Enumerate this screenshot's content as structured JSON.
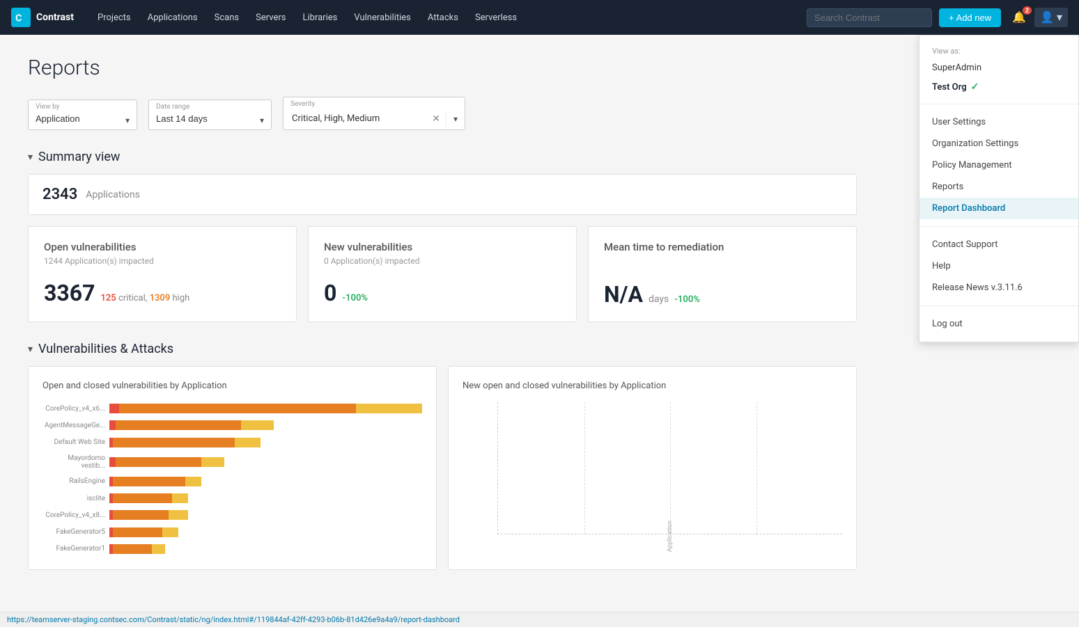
{
  "navbar": {
    "logo_text": "Contrast",
    "nav_items": [
      {
        "label": "Projects",
        "id": "projects"
      },
      {
        "label": "Applications",
        "id": "applications"
      },
      {
        "label": "Scans",
        "id": "scans"
      },
      {
        "label": "Servers",
        "id": "servers"
      },
      {
        "label": "Libraries",
        "id": "libraries"
      },
      {
        "label": "Vulnerabilities",
        "id": "vulnerabilities"
      },
      {
        "label": "Attacks",
        "id": "attacks"
      },
      {
        "label": "Serverless",
        "id": "serverless"
      }
    ],
    "search_placeholder": "Search Contrast",
    "add_new_label": "+ Add new",
    "notification_count": "2"
  },
  "dropdown_menu": {
    "view_as_label": "View as:",
    "users": [
      {
        "label": "SuperAdmin",
        "active": false
      },
      {
        "label": "Test Org",
        "active": true
      }
    ],
    "items": [
      {
        "label": "User Settings",
        "id": "user-settings",
        "highlighted": false
      },
      {
        "label": "Organization Settings",
        "id": "org-settings",
        "highlighted": false
      },
      {
        "label": "Policy Management",
        "id": "policy-mgmt",
        "highlighted": false
      },
      {
        "label": "Reports",
        "id": "reports",
        "highlighted": false
      },
      {
        "label": "Report Dashboard",
        "id": "report-dashboard",
        "highlighted": true
      },
      {
        "label": "Contact Support",
        "id": "contact-support",
        "highlighted": false
      },
      {
        "label": "Help",
        "id": "help",
        "highlighted": false
      },
      {
        "label": "Release News v.3.11.6",
        "id": "release-news",
        "highlighted": false
      },
      {
        "label": "Log out",
        "id": "logout",
        "highlighted": false
      }
    ]
  },
  "page": {
    "title": "Reports"
  },
  "filters": {
    "view_by_label": "View by",
    "view_by_value": "Application",
    "date_range_label": "Date range",
    "date_range_value": "Last 14 days",
    "severity_label": "Severity",
    "severity_value": "Critical, High, Medium"
  },
  "summary_view": {
    "title": "Summary view",
    "app_count": "2343",
    "app_count_label": "Applications",
    "metrics": [
      {
        "title": "Open vulnerabilities",
        "subtitle": "1244 Application(s) impacted",
        "value": "3367",
        "details": "125 critical, 1309 high",
        "change": null,
        "unit": null
      },
      {
        "title": "New vulnerabilities",
        "subtitle": "0 Application(s) impacted",
        "value": "0",
        "details": null,
        "change": "-100%",
        "unit": null
      },
      {
        "title": "Mean time to remediation",
        "subtitle": null,
        "value": "N/A",
        "details": null,
        "change": "-100%",
        "unit": "days"
      }
    ]
  },
  "vulns_section": {
    "title": "Vulnerabilities & Attacks",
    "chart1_title": "Open and closed vulnerabilities by Application",
    "chart2_title": "New open and closed vulnerabilities by Application",
    "bars": [
      {
        "label": "CorePolicy_v4_x6...",
        "orange": 72,
        "yellow": 20,
        "red": 3
      },
      {
        "label": "AgentMessageGe...",
        "orange": 38,
        "yellow": 10,
        "red": 2
      },
      {
        "label": "Default Web Site",
        "orange": 37,
        "yellow": 8,
        "red": 1
      },
      {
        "label": "Mayordomo vestib...",
        "orange": 26,
        "yellow": 7,
        "red": 2
      },
      {
        "label": "RailsEngine",
        "orange": 22,
        "yellow": 5,
        "red": 1
      },
      {
        "label": "isclite",
        "orange": 18,
        "yellow": 5,
        "red": 1
      },
      {
        "label": "CorePolicy_v4_x8...",
        "orange": 17,
        "yellow": 6,
        "red": 1
      },
      {
        "label": "FakeGenerator5",
        "orange": 15,
        "yellow": 5,
        "red": 1
      },
      {
        "label": "FakeGenerator1",
        "orange": 12,
        "yellow": 4,
        "red": 1
      }
    ]
  },
  "status_bar": {
    "url": "https://teamserver-staging.contsec.com/Contrast/static/ng/index.html#/119844af-42ff-4293-b06b-81d426e9a4a9/report-dashboard"
  }
}
